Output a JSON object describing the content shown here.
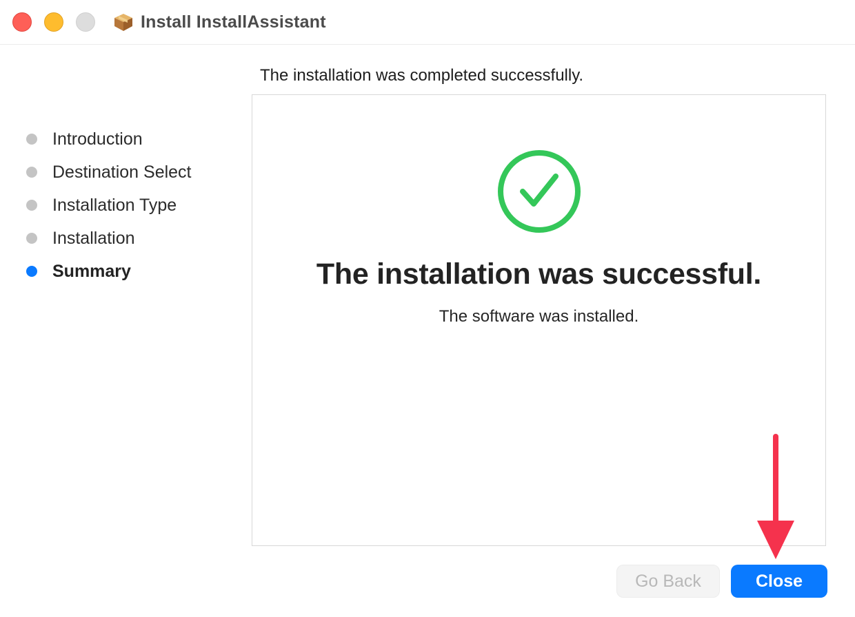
{
  "window": {
    "title": "Install InstallAssistant",
    "package_icon": "package-icon"
  },
  "header": {
    "text": "The installation was completed successfully."
  },
  "sidebar": {
    "steps": [
      {
        "label": "Introduction",
        "active": false
      },
      {
        "label": "Destination Select",
        "active": false
      },
      {
        "label": "Installation Type",
        "active": false
      },
      {
        "label": "Installation",
        "active": false
      },
      {
        "label": "Summary",
        "active": true
      }
    ]
  },
  "main": {
    "status_icon": "success-checkmark-icon",
    "title": "The installation was successful.",
    "message": "The software was installed."
  },
  "buttons": {
    "back_label": "Go Back",
    "close_label": "Close"
  },
  "colors": {
    "accent": "#0a7aff",
    "success": "#34c759",
    "annotation_arrow": "#f5324d"
  }
}
